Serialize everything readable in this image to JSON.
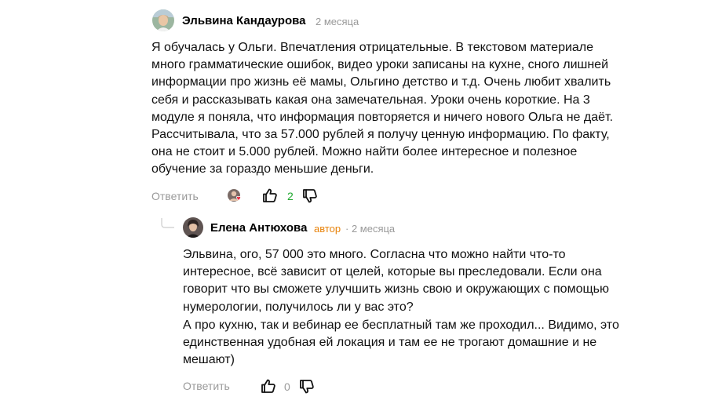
{
  "comments": [
    {
      "author": "Эльвина Кандаурова",
      "time": "2 месяца",
      "text": "Я обучалась у Ольги. Впечатления отрицательные. В текстовом материале много грамматические ошибок, видео уроки записаны на кухне, сного лишней информации про жизнь её мамы, Ольгино детство и т.д. Очень любит хвалить себя и рассказывать какая она замечательная. Уроки очень короткие. На 3 модуле я поняла, что информация повторяется и ничего нового Ольга не даёт. Рассчитывала, что за 57.000 рублей я получу ценную информацию. По факту, она не стоит и 5.000 рублей. Можно найти более интересное и полезное обучение за гораздо меньшие деньги.",
      "reply_label": "Ответить",
      "likes": "2",
      "icons": {
        "avatar": "user-avatar-photo",
        "liked_by": "author-liked-avatar-with-heart",
        "like": "thumbs-up-icon",
        "dislike": "thumbs-down-icon"
      }
    }
  ],
  "reply": {
    "author": "Елена Антюхова",
    "author_tag": "автор",
    "time": "· 2 месяца",
    "paragraphs": [
      "Эльвина, ого, 57 000 это много. Согласна что можно найти что-то интересное, всё зависит от целей, которые вы преследовали. Если она говорит что вы сможете улучшить жизнь свою и окружающих с помощью нумерологии, получилось ли у вас это?",
      "А про кухню, так и вебинар ее бесплатный там же проходил... Видимо, это единственная удобная ей локация и там ее не трогают домашние и не мешают)"
    ],
    "reply_label": "Ответить",
    "likes": "0",
    "icons": {
      "thread": "reply-thread-connector",
      "like": "thumbs-up-icon",
      "dislike": "thumbs-down-icon"
    }
  },
  "colors": {
    "author_tag": "#e8830b",
    "likes_positive": "#1fa82e",
    "muted": "#999999"
  }
}
